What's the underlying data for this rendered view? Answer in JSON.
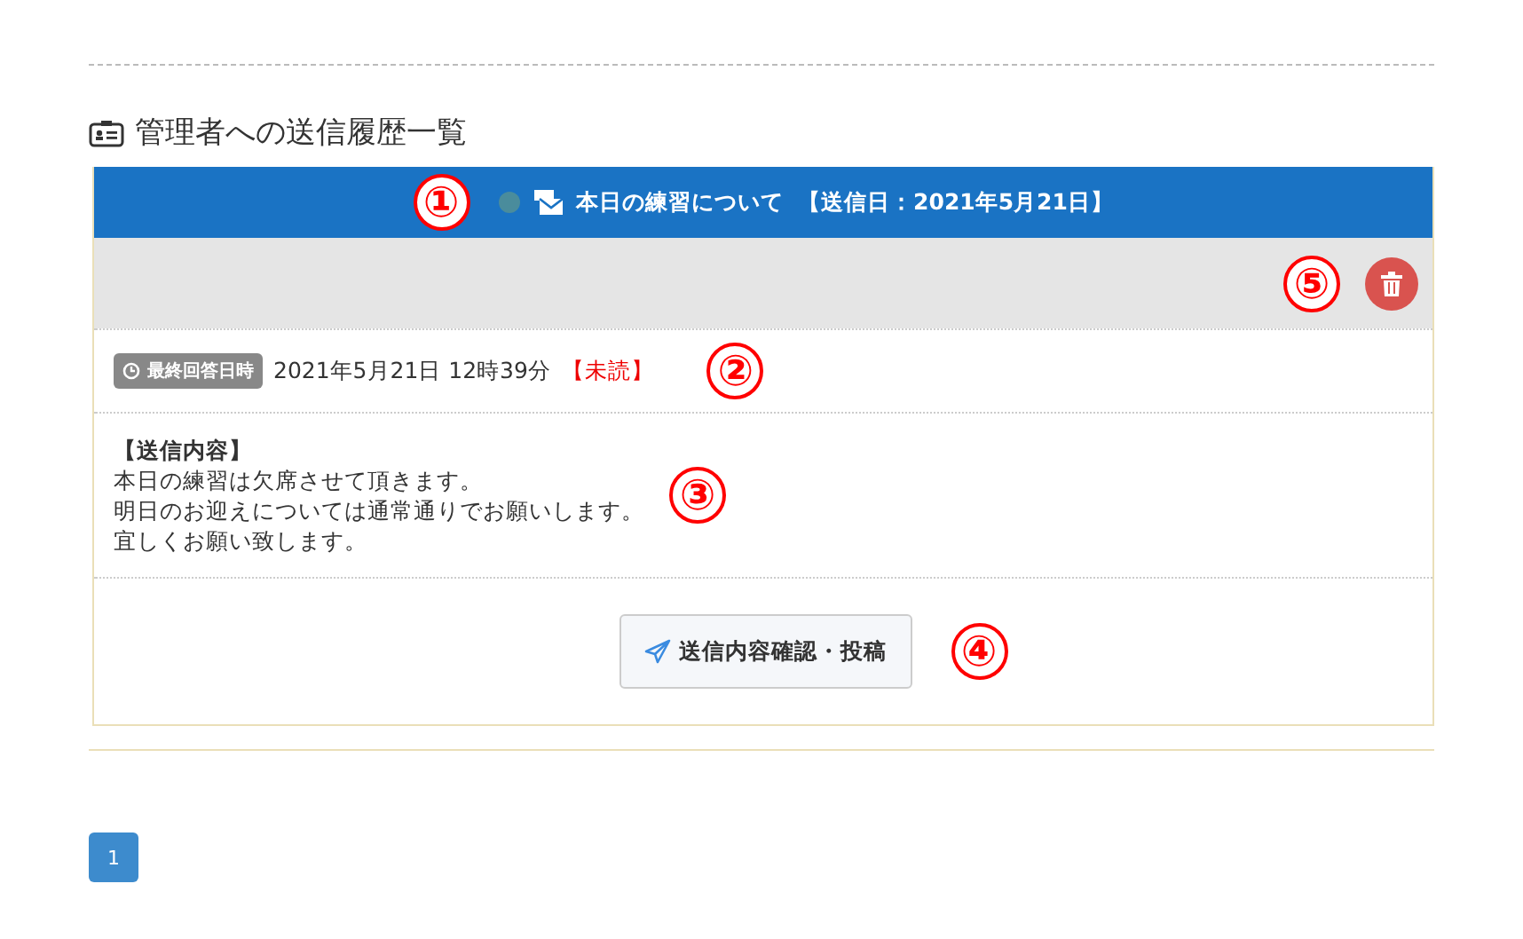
{
  "section_title": "管理者への送信履歴一覧",
  "messages": [
    {
      "color": "#4a8c9c",
      "title": "本日の練習について",
      "sent_date": "【送信日：2021年5月21日】",
      "header_callout": "①",
      "delete_callout": "⑤",
      "answer_label": "最終回答日時",
      "answer_time": "2021年5月21日 12時39分",
      "read_status": "【未読】",
      "answer_callout": "②",
      "content_heading": "【送信内容】",
      "content_lines": [
        "本日の練習は欠席させて頂きます。",
        "明日のお迎えについては通常通りでお願いします。",
        "宜しくお願い致します。"
      ],
      "content_callout": "③",
      "button": "送信内容確認・投稿",
      "button_callout": "④"
    }
  ],
  "pagination": [
    {
      "label": "1",
      "selected": true
    }
  ]
}
